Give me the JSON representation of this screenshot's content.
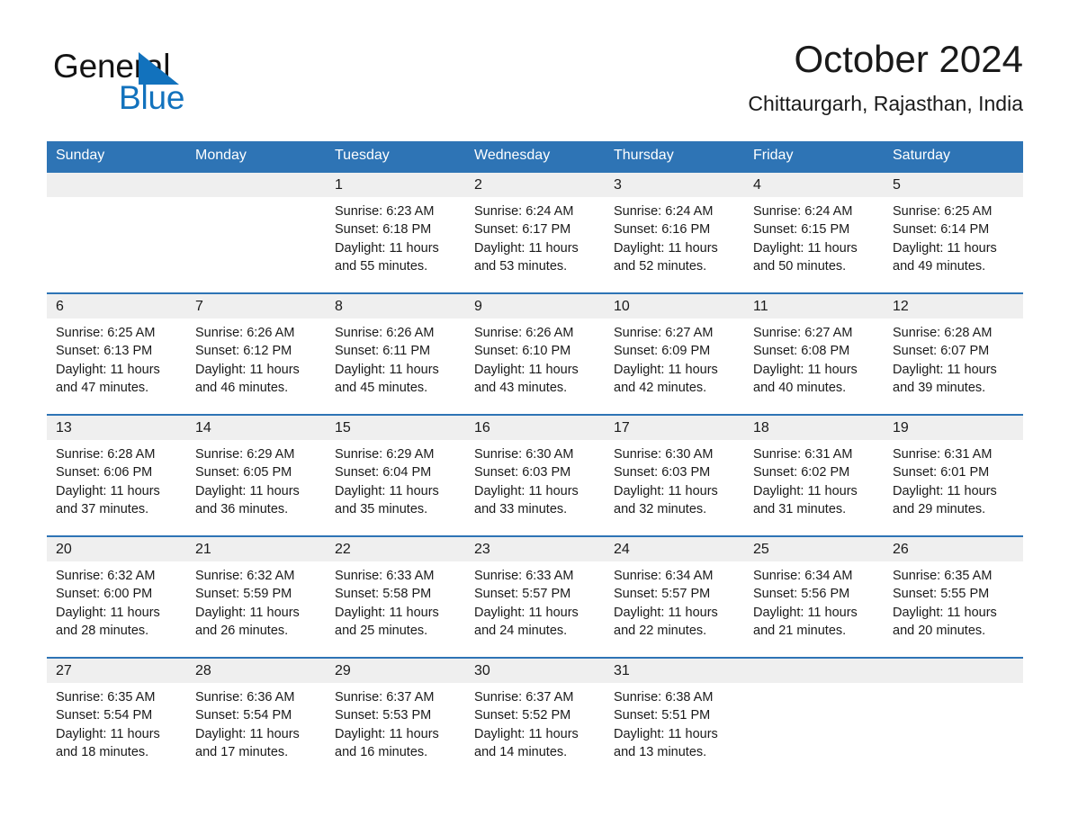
{
  "brand": {
    "name_part1": "General",
    "name_part2": "Blue",
    "accent_color": "#1272bd",
    "triangle_icon": "triangle-icon"
  },
  "header": {
    "title": "October 2024",
    "subtitle": "Chittaurgarh, Rajasthan, India"
  },
  "theme": {
    "header_blue": "#2e74b5",
    "day_band_gray": "#efefef",
    "text": "#1a1a1a"
  },
  "calendar": {
    "weekday_headers": [
      "Sunday",
      "Monday",
      "Tuesday",
      "Wednesday",
      "Thursday",
      "Friday",
      "Saturday"
    ],
    "weeks": [
      [
        {
          "day": "",
          "sunrise": "",
          "sunset": "",
          "daylight": ""
        },
        {
          "day": "",
          "sunrise": "",
          "sunset": "",
          "daylight": ""
        },
        {
          "day": "1",
          "sunrise": "Sunrise: 6:23 AM",
          "sunset": "Sunset: 6:18 PM",
          "daylight": "Daylight: 11 hours and 55 minutes."
        },
        {
          "day": "2",
          "sunrise": "Sunrise: 6:24 AM",
          "sunset": "Sunset: 6:17 PM",
          "daylight": "Daylight: 11 hours and 53 minutes."
        },
        {
          "day": "3",
          "sunrise": "Sunrise: 6:24 AM",
          "sunset": "Sunset: 6:16 PM",
          "daylight": "Daylight: 11 hours and 52 minutes."
        },
        {
          "day": "4",
          "sunrise": "Sunrise: 6:24 AM",
          "sunset": "Sunset: 6:15 PM",
          "daylight": "Daylight: 11 hours and 50 minutes."
        },
        {
          "day": "5",
          "sunrise": "Sunrise: 6:25 AM",
          "sunset": "Sunset: 6:14 PM",
          "daylight": "Daylight: 11 hours and 49 minutes."
        }
      ],
      [
        {
          "day": "6",
          "sunrise": "Sunrise: 6:25 AM",
          "sunset": "Sunset: 6:13 PM",
          "daylight": "Daylight: 11 hours and 47 minutes."
        },
        {
          "day": "7",
          "sunrise": "Sunrise: 6:26 AM",
          "sunset": "Sunset: 6:12 PM",
          "daylight": "Daylight: 11 hours and 46 minutes."
        },
        {
          "day": "8",
          "sunrise": "Sunrise: 6:26 AM",
          "sunset": "Sunset: 6:11 PM",
          "daylight": "Daylight: 11 hours and 45 minutes."
        },
        {
          "day": "9",
          "sunrise": "Sunrise: 6:26 AM",
          "sunset": "Sunset: 6:10 PM",
          "daylight": "Daylight: 11 hours and 43 minutes."
        },
        {
          "day": "10",
          "sunrise": "Sunrise: 6:27 AM",
          "sunset": "Sunset: 6:09 PM",
          "daylight": "Daylight: 11 hours and 42 minutes."
        },
        {
          "day": "11",
          "sunrise": "Sunrise: 6:27 AM",
          "sunset": "Sunset: 6:08 PM",
          "daylight": "Daylight: 11 hours and 40 minutes."
        },
        {
          "day": "12",
          "sunrise": "Sunrise: 6:28 AM",
          "sunset": "Sunset: 6:07 PM",
          "daylight": "Daylight: 11 hours and 39 minutes."
        }
      ],
      [
        {
          "day": "13",
          "sunrise": "Sunrise: 6:28 AM",
          "sunset": "Sunset: 6:06 PM",
          "daylight": "Daylight: 11 hours and 37 minutes."
        },
        {
          "day": "14",
          "sunrise": "Sunrise: 6:29 AM",
          "sunset": "Sunset: 6:05 PM",
          "daylight": "Daylight: 11 hours and 36 minutes."
        },
        {
          "day": "15",
          "sunrise": "Sunrise: 6:29 AM",
          "sunset": "Sunset: 6:04 PM",
          "daylight": "Daylight: 11 hours and 35 minutes."
        },
        {
          "day": "16",
          "sunrise": "Sunrise: 6:30 AM",
          "sunset": "Sunset: 6:03 PM",
          "daylight": "Daylight: 11 hours and 33 minutes."
        },
        {
          "day": "17",
          "sunrise": "Sunrise: 6:30 AM",
          "sunset": "Sunset: 6:03 PM",
          "daylight": "Daylight: 11 hours and 32 minutes."
        },
        {
          "day": "18",
          "sunrise": "Sunrise: 6:31 AM",
          "sunset": "Sunset: 6:02 PM",
          "daylight": "Daylight: 11 hours and 31 minutes."
        },
        {
          "day": "19",
          "sunrise": "Sunrise: 6:31 AM",
          "sunset": "Sunset: 6:01 PM",
          "daylight": "Daylight: 11 hours and 29 minutes."
        }
      ],
      [
        {
          "day": "20",
          "sunrise": "Sunrise: 6:32 AM",
          "sunset": "Sunset: 6:00 PM",
          "daylight": "Daylight: 11 hours and 28 minutes."
        },
        {
          "day": "21",
          "sunrise": "Sunrise: 6:32 AM",
          "sunset": "Sunset: 5:59 PM",
          "daylight": "Daylight: 11 hours and 26 minutes."
        },
        {
          "day": "22",
          "sunrise": "Sunrise: 6:33 AM",
          "sunset": "Sunset: 5:58 PM",
          "daylight": "Daylight: 11 hours and 25 minutes."
        },
        {
          "day": "23",
          "sunrise": "Sunrise: 6:33 AM",
          "sunset": "Sunset: 5:57 PM",
          "daylight": "Daylight: 11 hours and 24 minutes."
        },
        {
          "day": "24",
          "sunrise": "Sunrise: 6:34 AM",
          "sunset": "Sunset: 5:57 PM",
          "daylight": "Daylight: 11 hours and 22 minutes."
        },
        {
          "day": "25",
          "sunrise": "Sunrise: 6:34 AM",
          "sunset": "Sunset: 5:56 PM",
          "daylight": "Daylight: 11 hours and 21 minutes."
        },
        {
          "day": "26",
          "sunrise": "Sunrise: 6:35 AM",
          "sunset": "Sunset: 5:55 PM",
          "daylight": "Daylight: 11 hours and 20 minutes."
        }
      ],
      [
        {
          "day": "27",
          "sunrise": "Sunrise: 6:35 AM",
          "sunset": "Sunset: 5:54 PM",
          "daylight": "Daylight: 11 hours and 18 minutes."
        },
        {
          "day": "28",
          "sunrise": "Sunrise: 6:36 AM",
          "sunset": "Sunset: 5:54 PM",
          "daylight": "Daylight: 11 hours and 17 minutes."
        },
        {
          "day": "29",
          "sunrise": "Sunrise: 6:37 AM",
          "sunset": "Sunset: 5:53 PM",
          "daylight": "Daylight: 11 hours and 16 minutes."
        },
        {
          "day": "30",
          "sunrise": "Sunrise: 6:37 AM",
          "sunset": "Sunset: 5:52 PM",
          "daylight": "Daylight: 11 hours and 14 minutes."
        },
        {
          "day": "31",
          "sunrise": "Sunrise: 6:38 AM",
          "sunset": "Sunset: 5:51 PM",
          "daylight": "Daylight: 11 hours and 13 minutes."
        },
        {
          "day": "",
          "sunrise": "",
          "sunset": "",
          "daylight": ""
        },
        {
          "day": "",
          "sunrise": "",
          "sunset": "",
          "daylight": ""
        }
      ]
    ]
  }
}
